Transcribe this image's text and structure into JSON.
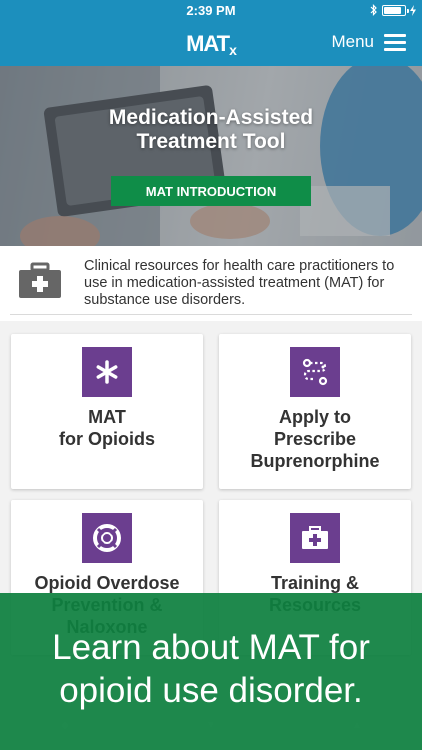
{
  "status": {
    "time": "2:39 PM",
    "battery_level": 0.9
  },
  "header": {
    "logo_main": "MAT",
    "logo_sub": "x",
    "menu_label": "Menu"
  },
  "hero": {
    "title_line1": "Medication-Assisted",
    "title_line2": "Treatment Tool",
    "button_label": "MAT INTRODUCTION"
  },
  "intro": {
    "text": "Clinical resources for health care practitioners to use in medication-assisted treatment (MAT) for substance use disorders."
  },
  "cards": [
    {
      "label": "MAT\nfor Opioids",
      "icon": "asterisk-icon"
    },
    {
      "label": "Apply to\nPrescribe\nBuprenorphine",
      "icon": "route-icon"
    },
    {
      "label": "Opioid Overdose\nPrevention &\nNaloxone",
      "icon": "lifebuoy-icon"
    },
    {
      "label": "Training &\nResources",
      "icon": "medical-kit-icon"
    }
  ],
  "banner": {
    "line1": "Learn about MAT for",
    "line2": "opioid use disorder."
  },
  "colors": {
    "header": "#1c8fbd",
    "accent_green": "#0f8d48",
    "card_icon": "#6b3e8f",
    "banner": "#0e803f"
  }
}
